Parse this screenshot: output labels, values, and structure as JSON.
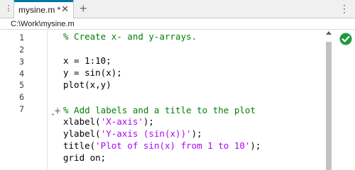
{
  "tabs": {
    "overflow_glyph": "⋮",
    "active_label": "mysine.m *",
    "close_glyph": "✕",
    "new_tab_glyph": "+",
    "menu_glyph": "⋮"
  },
  "path": "C:\\Work\\mysine.m",
  "line_numbers": [
    "1",
    "2",
    "3",
    "4",
    "5",
    "6",
    "7"
  ],
  "code": {
    "l1": "% Create x- and y-arrays.",
    "l3": "x = 1:10;",
    "l4": "y = sin(x);",
    "l5": "plot(x,y)",
    "l7": "% Add labels and a title to the plot",
    "l8_fn": "xlabel(",
    "l8_str": "'X-axis'",
    "l8_end": ");",
    "l9_fn": "ylabel(",
    "l9_str": "'Y-axis (sin(x))'",
    "l9_end": ");",
    "l10_fn": "title(",
    "l10_str": "'Plot of sin(x) from 1 to 10'",
    "l10_end": ");",
    "l11": "grid on;"
  },
  "colors": {
    "comment": "#028009",
    "string": "#a709f5",
    "tab_accent": "#0076a8",
    "status_ok": "#1e9a3b"
  },
  "icons": {
    "status": "checkmark-icon",
    "sparkle": "sparkle-icon"
  }
}
